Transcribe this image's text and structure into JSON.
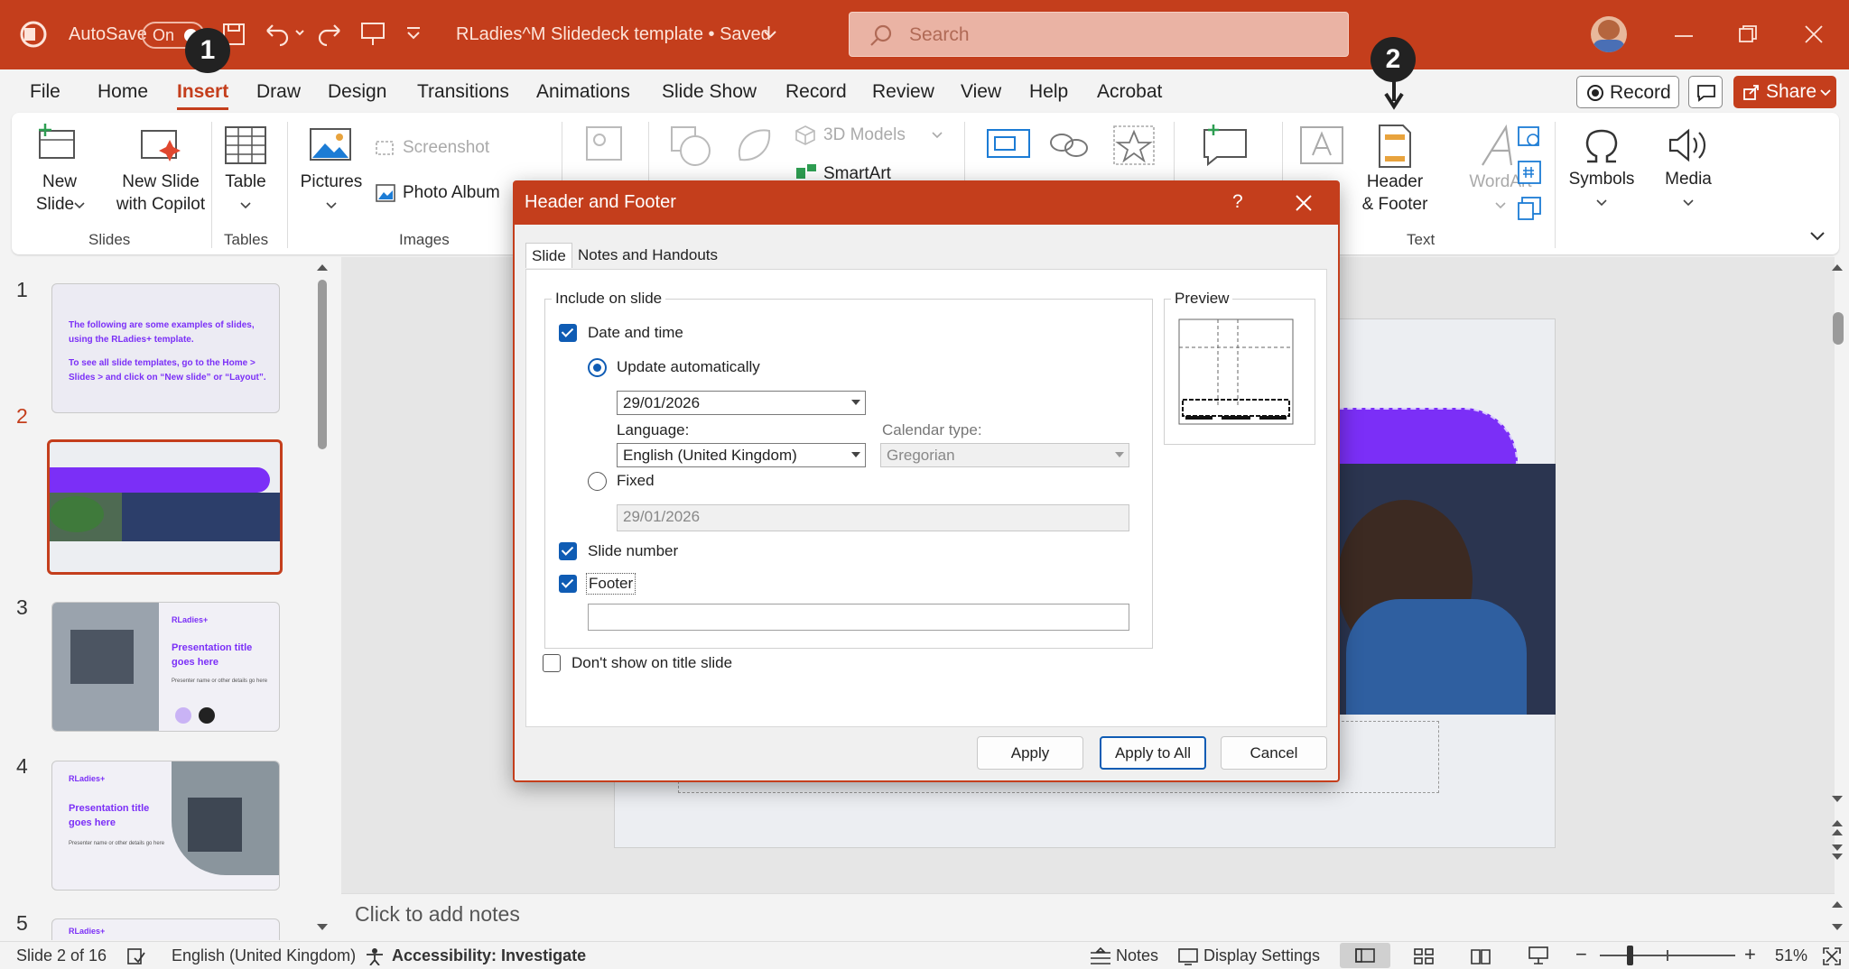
{
  "titlebar": {
    "autosave_label": "AutoSave",
    "autosave_state": "On",
    "doc_title": "RLadies^M Slidedeck template • Saved",
    "search_placeholder": "Search"
  },
  "menu": {
    "items": [
      "File",
      "Home",
      "Insert",
      "Draw",
      "Design",
      "Transitions",
      "Animations",
      "Slide Show",
      "Record",
      "Review",
      "View",
      "Help",
      "Acrobat"
    ],
    "active": "Insert",
    "record_label": "Record",
    "share_label": "Share"
  },
  "ribbon": {
    "new_slide": "New Slide",
    "new_slide_l1": "New",
    "new_slide_l2": "Slide",
    "new_slide_copilot_l1": "New Slide",
    "new_slide_copilot_l2": "with Copilot",
    "table": "Table",
    "pictures": "Pictures",
    "screenshot": "Screenshot",
    "photo_album": "Photo Album",
    "models_3d": "3D Models",
    "smartart": "SmartArt",
    "header_footer_l1": "Header",
    "header_footer_l2": "& Footer",
    "wordart": "WordArt",
    "symbols": "Symbols",
    "media": "Media",
    "groups": {
      "slides": "Slides",
      "tables": "Tables",
      "images": "Images",
      "text": "Text"
    }
  },
  "annotations": {
    "badge1": "1",
    "badge2": "2"
  },
  "thumbnails": {
    "nums": [
      "1",
      "2",
      "3",
      "4",
      "5"
    ],
    "t1_line1": "The following are some examples of slides,",
    "t1_line2": "using the RLadies+ template.",
    "t1_line3": "To see all slide templates, go to the Home >",
    "t1_line4": "Slides > and click on “New slide” or “Layout”.",
    "t3_brand": "RLadies+",
    "t3_title1": "Presentation title",
    "t3_title2": "goes here",
    "t3_sub": "Presenter name or other details go here",
    "t4_brand": "RLadies+",
    "t4_title1": "Presentation title",
    "t4_title2": "goes here",
    "t4_sub": "Presenter name or other details go here",
    "t5_brand": "RLadies+"
  },
  "notes_placeholder": "Click to add notes",
  "statusbar": {
    "slide_info": "Slide 2 of 16",
    "language": "English (United Kingdom)",
    "accessibility": "Accessibility: Investigate",
    "notes": "Notes",
    "display_settings": "Display Settings",
    "zoom": "51%"
  },
  "dialog": {
    "title": "Header and Footer",
    "help": "?",
    "tabs": [
      "Slide",
      "Notes and Handouts"
    ],
    "include_label": "Include on slide",
    "date_time_label": "Date and time",
    "date_time_checked": true,
    "update_auto_label": "Update automatically",
    "date_value": "29/01/2026",
    "language_label": "Language:",
    "language_value": "English (United Kingdom)",
    "calendar_label": "Calendar type:",
    "calendar_value": "Gregorian",
    "fixed_label": "Fixed",
    "fixed_value": "29/01/2026",
    "slide_number_label": "Slide number",
    "slide_number_checked": true,
    "footer_label": "Footer",
    "footer_checked": true,
    "footer_value": "",
    "dont_show_label": "Don't show on title slide",
    "dont_show_checked": false,
    "preview_label": "Preview",
    "apply_label": "Apply",
    "apply_all_label": "Apply to All",
    "cancel_label": "Cancel"
  },
  "colors": {
    "accent": "#c43e1c",
    "purple": "#7b2ff7",
    "checkbox_blue": "#0f5cb4"
  }
}
